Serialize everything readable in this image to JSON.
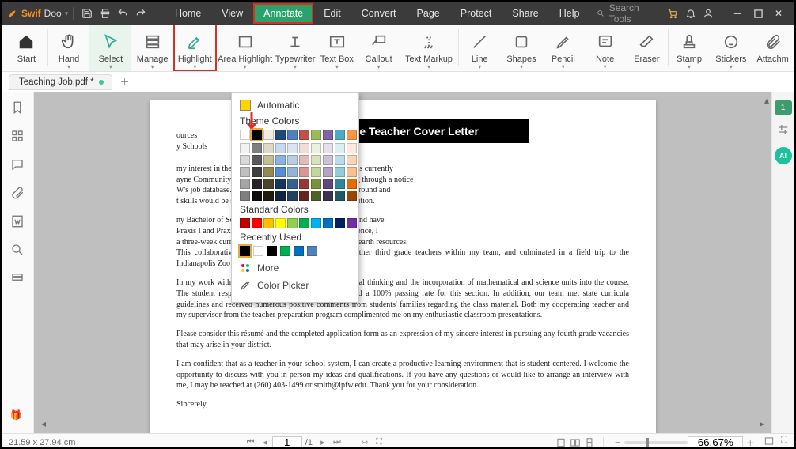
{
  "brand": {
    "name1": "Swif",
    "name2": "Doo"
  },
  "menu": {
    "home": "Home",
    "view": "View",
    "annotate": "Annotate",
    "edit": "Edit",
    "convert": "Convert",
    "page": "Page",
    "protect": "Protect",
    "share": "Share",
    "help": "Help"
  },
  "search": {
    "placeholder": "Search Tools"
  },
  "ribbon": {
    "start": "Start",
    "hand": "Hand",
    "select": "Select",
    "manage": "Manage",
    "highlight": "Highlight",
    "areaHighlight": "Area Highlight",
    "typewriter": "Typewriter",
    "textbox": "Text Box",
    "callout": "Callout",
    "textmarkup": "Text Markup",
    "line": "Line",
    "shapes": "Shapes",
    "pencil": "Pencil",
    "note": "Note",
    "eraser": "Eraser",
    "stamp": "Stamp",
    "stickers": "Stickers",
    "attach": "Attachm"
  },
  "tab": {
    "name": "Teaching Job.pdf *"
  },
  "popup": {
    "automatic": "Automatic",
    "theme": "Theme Colors",
    "standard": "Standard Colors",
    "recent": "Recently Used",
    "more": "More",
    "picker": "Color Picker",
    "themeBase": [
      "#ffffff",
      "#000000",
      "#eeece1",
      "#1f497d",
      "#4f81bd",
      "#c0504d",
      "#9bbb59",
      "#8064a2",
      "#4bacc6",
      "#f79646"
    ],
    "themeShades": [
      [
        "#f2f2f2",
        "#7f7f7f",
        "#ddd9c3",
        "#c6d9f0",
        "#dbe5f1",
        "#f2dcdb",
        "#ebf1dd",
        "#e5e0ec",
        "#dbeef3",
        "#fdeada"
      ],
      [
        "#d8d8d8",
        "#595959",
        "#c4bd97",
        "#8db3e2",
        "#b8cce4",
        "#e5b9b7",
        "#d7e3bc",
        "#ccc1d9",
        "#b7dde8",
        "#fbd5b5"
      ],
      [
        "#bfbfbf",
        "#3f3f3f",
        "#938953",
        "#548dd4",
        "#95b3d7",
        "#d99694",
        "#c3d69b",
        "#b2a2c7",
        "#92cddc",
        "#fac08f"
      ],
      [
        "#a5a5a5",
        "#262626",
        "#494429",
        "#17365d",
        "#366092",
        "#953734",
        "#76923c",
        "#5f497a",
        "#31859b",
        "#e36c09"
      ],
      [
        "#7f7f7f",
        "#0c0c0c",
        "#1d1b10",
        "#0f243e",
        "#244061",
        "#632423",
        "#4f6128",
        "#3f3151",
        "#205867",
        "#974806"
      ]
    ],
    "standardColors": [
      "#c00000",
      "#ff0000",
      "#ffc000",
      "#ffff00",
      "#92d050",
      "#00b050",
      "#00b0f0",
      "#0070c0",
      "#002060",
      "#7030a0"
    ],
    "recentColors": [
      "#000000",
      "#ffffff",
      "#000000",
      "#00b050",
      "#0070c0",
      "#4f81bd"
    ]
  },
  "document": {
    "banner": "Sample Teacher Cover Letter",
    "addr1": "",
    "addr2_a": "ources",
    "addr2_b": "y Schools",
    "p1a": "my interest in the fourth grade instructional position that is currently",
    "p1b": "ayne Community School System. I learned of the opening through a notice",
    "p1c": "W's job database. I am confident that my academic background and",
    "p1d": "t skills would be successfully utilized in this teaching position.",
    "p2a": "ny Bachelor of Science degree in Elementary Education and have",
    "p2b": "Praxis I and Praxis II. During my student teaching experience, I",
    "p2c": "a three-week curriculum sequence on animal species and earth resources.",
    "p2d": "This collaborative unit involved working with three other third grade teachers within my team, and culminated in a field trip to the Indianapolis Zoo Animal Research Unit.",
    "p3": "In my work with the third grade classes, I stressed critical thinking and the incorporation of mathematical and science units into the course.  The student response was very encouraging, as we had a 100% passing rate for this section.  In addition, our team met state curricula guidelines and received numerous positive comments from students' families regarding the class material. Both my cooperating teacher and my supervisor from the teacher preparation program complimented me on my enthusiastic classroom presentations.",
    "p4": "Please consider this résumé and the completed application form as an expression of my sincere interest in pursuing any fourth grade vacancies that may arise in your district.",
    "p5": "I am confident that as a teacher in your school system, I can create a productive learning environment that is student-centered. I welcome the opportunity to discuss with you in person my ideas and qualifications. If you have any questions or would like to arrange an interview with me, I may be reached at (260) 403-1499 or smith@ipfw.edu. Thank you for your consideration.",
    "closing": "Sincerely,"
  },
  "status": {
    "dim": "21.59 x 27.94 cm",
    "page": "1",
    "totalPrefix": "/",
    "total": "1",
    "zoom": "66.67%"
  },
  "right": {
    "pagecount": "1",
    "ai": "AI"
  }
}
